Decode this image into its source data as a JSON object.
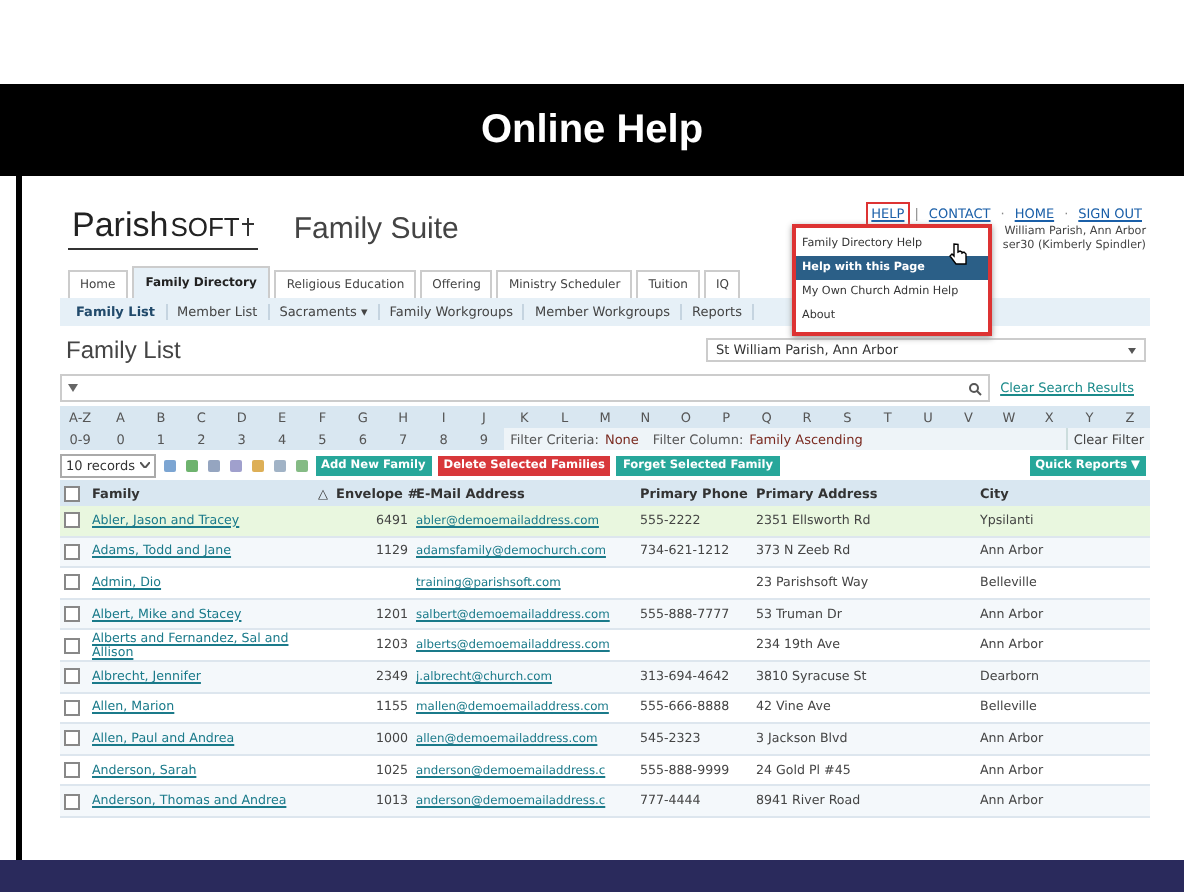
{
  "slide": {
    "title": "Online Help"
  },
  "app": {
    "logo": {
      "main": "Parish",
      "sub": "SOFT"
    },
    "suite": "Family Suite",
    "top_links": [
      {
        "label": "HELP",
        "selected": true
      },
      {
        "label": "CONTACT",
        "selected": false,
        "sep": "|"
      },
      {
        "label": "HOME",
        "selected": false,
        "sep": "·"
      },
      {
        "label": "SIGN OUT",
        "selected": false,
        "sep": "·"
      }
    ],
    "user_lines": [
      "William Parish, Ann Arbor",
      "ser30 (Kimberly Spindler)"
    ],
    "help_menu": [
      {
        "label": "Family Directory Help",
        "selected": false
      },
      {
        "label": "Help with this Page",
        "selected": true
      },
      {
        "label": "My Own Church Admin Help",
        "selected": false
      },
      {
        "label": "About",
        "selected": false
      }
    ],
    "tabs": [
      {
        "label": "Home",
        "selected": false
      },
      {
        "label": "Family Directory",
        "selected": true
      },
      {
        "label": "Religious Education",
        "selected": false
      },
      {
        "label": "Offering",
        "selected": false
      },
      {
        "label": "Ministry Scheduler",
        "selected": false
      },
      {
        "label": "Tuition",
        "selected": false
      },
      {
        "label": "IQ",
        "selected": false
      }
    ],
    "subnav": [
      {
        "label": "Family List",
        "selected": true
      },
      {
        "label": "Member List",
        "selected": false
      },
      {
        "label": "Sacraments ▾",
        "selected": false
      },
      {
        "label": "Family Workgroups",
        "selected": false
      },
      {
        "label": "Member Workgroups",
        "selected": false
      },
      {
        "label": "Reports",
        "selected": false
      }
    ],
    "page_title": "Family List",
    "parish_select": "St William Parish, Ann Arbor",
    "search": {
      "link": "Clear Search Results"
    },
    "alpha_rows": [
      [
        "A-Z",
        "A",
        "B",
        "C",
        "D",
        "E",
        "F",
        "G",
        "H",
        "I",
        "J",
        "K",
        "L",
        "M",
        "N",
        "O",
        "P",
        "Q",
        "R",
        "S",
        "T",
        "U",
        "V",
        "W",
        "X",
        "Y",
        "Z"
      ],
      [
        "0-9",
        "0",
        "1",
        "2",
        "3",
        "4",
        "5",
        "6",
        "7",
        "8",
        "9"
      ]
    ],
    "filter": {
      "criteria_label": "Filter Criteria:",
      "criteria": "None",
      "column_label": "Filter Column:",
      "column": "Family Ascending",
      "clear": "Clear Filter"
    },
    "records_select": "10 records",
    "actions": [
      {
        "label": "Add New Family",
        "kind": "primary"
      },
      {
        "label": "Delete Selected Families",
        "kind": "danger"
      },
      {
        "label": "Forget Selected Family",
        "kind": "primary"
      }
    ],
    "quick_reports": "Quick Reports ▼",
    "table": {
      "select_all_checked": false,
      "columns": [
        {
          "label": "Family",
          "sort": "△"
        },
        {
          "label": "Envelope #"
        },
        {
          "label": "E-Mail Address"
        },
        {
          "label": "Primary Phone"
        },
        {
          "label": "Primary Address"
        },
        {
          "label": "City"
        }
      ],
      "rows": [
        {
          "selected": true,
          "checked": false,
          "family": "Abler, Jason and Tracey",
          "envelope": "6491",
          "email": "abler@demoemailaddress.com",
          "phone": "555-2222",
          "address": "2351 Ellsworth Rd",
          "city": "Ypsilanti"
        },
        {
          "selected": false,
          "checked": false,
          "family": "Adams, Todd and Jane",
          "envelope": "1129",
          "email": "adamsfamily@demochurch.com",
          "phone": "734-621-1212",
          "address": "373 N Zeeb Rd",
          "city": "Ann Arbor"
        },
        {
          "selected": false,
          "checked": false,
          "family": "Admin, Dio",
          "envelope": "",
          "email": "training@parishsoft.com",
          "phone": "",
          "address": "23 Parishsoft Way",
          "city": "Belleville"
        },
        {
          "selected": false,
          "checked": false,
          "family": "Albert, Mike and Stacey",
          "envelope": "1201",
          "email": "salbert@demoemailaddress.com",
          "phone": "555-888-7777",
          "address": "53 Truman Dr",
          "city": "Ann Arbor"
        },
        {
          "selected": false,
          "checked": false,
          "family": "Alberts and Fernandez, Sal and Allison",
          "envelope": "1203",
          "email": "alberts@demoemailaddress.com",
          "phone": "",
          "address": "234 19th Ave",
          "city": "Ann Arbor"
        },
        {
          "selected": false,
          "checked": false,
          "family": "Albrecht, Jennifer",
          "envelope": "2349",
          "email": "j.albrecht@church.com",
          "phone": "313-694-4642",
          "address": "3810 Syracuse St",
          "city": "Dearborn"
        },
        {
          "selected": false,
          "checked": false,
          "family": "Allen, Marion",
          "envelope": "1155",
          "email": "mallen@demoemailaddress.com",
          "phone": "555-666-8888",
          "address": "42 Vine Ave",
          "city": "Belleville"
        },
        {
          "selected": false,
          "checked": false,
          "family": "Allen, Paul and Andrea",
          "envelope": "1000",
          "email": "allen@demoemailaddress.com",
          "phone": "545-2323",
          "address": "3 Jackson Blvd",
          "city": "Ann Arbor"
        },
        {
          "selected": false,
          "checked": false,
          "family": "Anderson, Sarah",
          "envelope": "1025",
          "email": "anderson@demoemailaddress.c",
          "phone": "555-888-9999",
          "address": "24 Gold Pl #45",
          "city": "Ann Arbor"
        },
        {
          "selected": false,
          "checked": false,
          "family": "Anderson, Thomas and Andrea",
          "envelope": "1013",
          "email": "anderson@demoemailaddress.c",
          "phone": "777-4444",
          "address": "8941 River Road",
          "city": "Ann Arbor"
        }
      ]
    }
  }
}
